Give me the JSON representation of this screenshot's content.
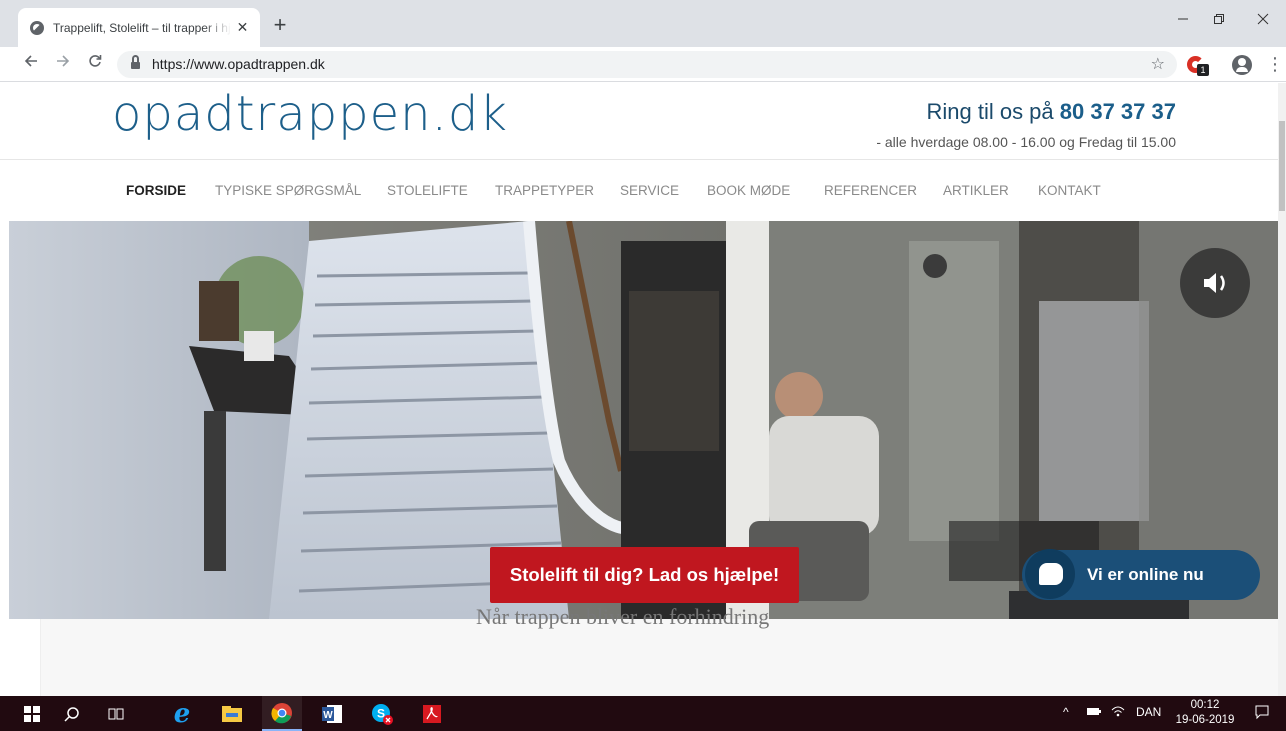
{
  "browser": {
    "tab_title": "Trappelift, Stolelift – til trapper i hjemmet",
    "tab_close": "✕",
    "new_tab": "+",
    "url": "https://www.opadtrappen.dk",
    "extension_badge": "1"
  },
  "site": {
    "logo": "opadtrappen.dk",
    "phone_prefix": "Ring til os på ",
    "phone_number": "80 37 37 37",
    "hours": "- alle hverdage 08.00 - 16.00 og Fredag til 15.00"
  },
  "nav": [
    {
      "label": "FORSIDE",
      "active": true
    },
    {
      "label": "TYPISKE SPØRGSMÅL"
    },
    {
      "label": "STOLELIFTE"
    },
    {
      "label": "TRAPPETYPER"
    },
    {
      "label": "SERVICE"
    },
    {
      "label": "BOOK MØDE"
    },
    {
      "label": "REFERENCER"
    },
    {
      "label": "ARTIKLER"
    },
    {
      "label": "KONTAKT"
    }
  ],
  "cta": {
    "label": "Stolelift til dig? Lad os hjælpe!",
    "subtext": "Når trappen bliver en forhindring"
  },
  "chat": {
    "label": "Vi er online nu"
  },
  "taskbar": {
    "language": "DAN",
    "time": "00:12",
    "date": "19-06-2019"
  },
  "colors": {
    "brand_blue": "#1d5f8a",
    "cta_red": "#c0171f",
    "chat_navy": "#1b4f78",
    "taskbar": "#210a10"
  }
}
